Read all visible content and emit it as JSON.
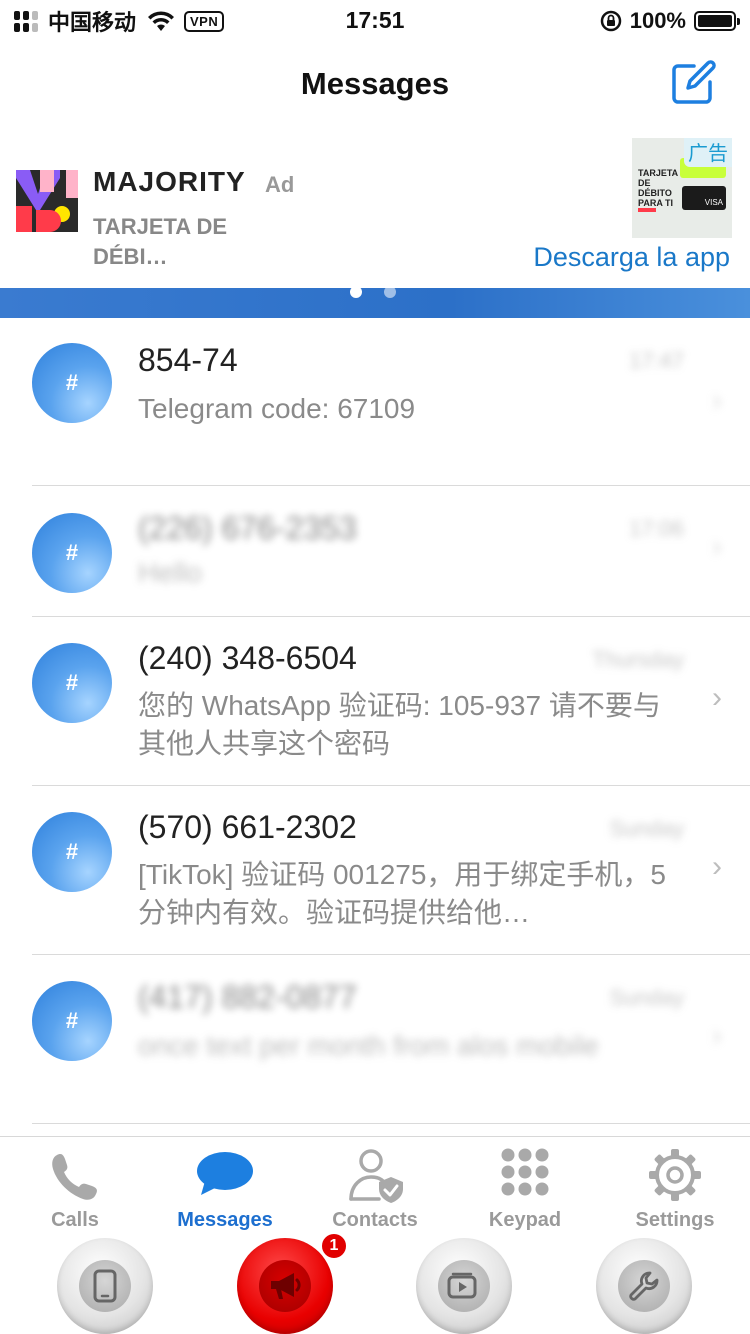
{
  "status_bar": {
    "carrier": "中国移动",
    "vpn": "VPN",
    "time": "17:51",
    "battery": "100%"
  },
  "header": {
    "title": "Messages",
    "compose_icon": "compose-icon"
  },
  "ad": {
    "brand": "MAJORITY",
    "tag": "Ad",
    "subtitle": "TARJETA DE DÉBI…",
    "badge": "广告",
    "cta": "Descarga la app",
    "thumb_title": "TARJETA DE DÉBITO PARA TI",
    "thumb_card": "VISA"
  },
  "messages": [
    {
      "name": "854-74",
      "preview": "Telegram code: 67109",
      "time": "17:47",
      "avatar": "#",
      "blurred_name": false,
      "blurred_preview": false,
      "blurred_time": true
    },
    {
      "name": "(226) 676-2353",
      "preview": "Hello",
      "time": "17:06",
      "avatar": "#",
      "blurred_name": true,
      "blurred_preview": true,
      "blurred_time": true
    },
    {
      "name": "(240) 348-6504",
      "preview": "您的 WhatsApp 验证码: 105-937 请不要与其他人共享这个密码",
      "time": "Thursday",
      "avatar": "#",
      "blurred_name": false,
      "blurred_preview": false,
      "blurred_time": true
    },
    {
      "name": "(570) 661-2302",
      "preview": "[TikTok] 验证码 001275，用于绑定手机，5分钟内有效。验证码提供给他…",
      "time": "Sunday",
      "avatar": "#",
      "blurred_name": false,
      "blurred_preview": false,
      "blurred_time": true
    },
    {
      "name": "(417) 882-0877",
      "preview": "once text per month from alos mobile",
      "time": "Sunday",
      "avatar": "#",
      "blurred_name": true,
      "blurred_preview": true,
      "blurred_time": true
    }
  ],
  "tabs": [
    {
      "label": "Calls",
      "icon": "phone-icon",
      "active": false
    },
    {
      "label": "Messages",
      "icon": "chat-bubble-icon",
      "active": true
    },
    {
      "label": "Contacts",
      "icon": "contact-shield-icon",
      "active": false
    },
    {
      "label": "Keypad",
      "icon": "keypad-icon",
      "active": false
    },
    {
      "label": "Settings",
      "icon": "gear-icon",
      "active": false
    }
  ],
  "floating_buttons": [
    {
      "icon": "smartphone-icon"
    },
    {
      "icon": "megaphone-icon",
      "badge": "1"
    },
    {
      "icon": "video-icon"
    },
    {
      "icon": "wrench-icon"
    }
  ],
  "colors": {
    "accent": "#1d6fcf",
    "avatar": "#3d8be0",
    "red_button": "#e80000"
  }
}
